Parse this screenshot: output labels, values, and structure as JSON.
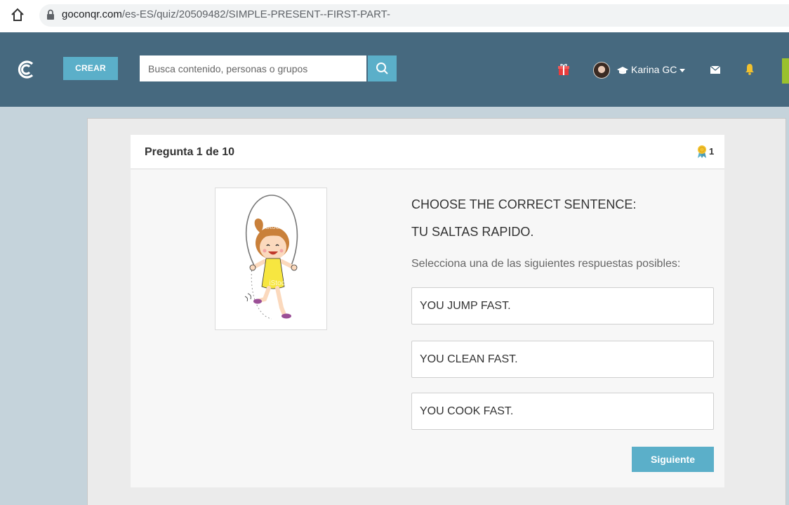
{
  "browser": {
    "url_domain": "goconqr.com",
    "url_path": "/es-ES/quiz/20509482/SIMPLE-PRESENT--FIRST-PART-"
  },
  "header": {
    "create_label": "CREAR",
    "search_placeholder": "Busca contenido, personas o grupos",
    "user_name": "Karina GC",
    "accent_color": "#5bafc9",
    "header_color": "#46697f"
  },
  "quiz": {
    "counter": "Pregunta 1 de 10",
    "points": "1",
    "question_line1": "CHOOSE THE CORRECT SENTENCE:",
    "question_line2": "TU SALTAS RAPIDO.",
    "instructions": "Selecciona una de las siguientes respuestas posibles:",
    "options": [
      "YOU JUMP FAST.",
      "YOU CLEAN FAST.",
      "YOU COOK FAST."
    ],
    "next_label": "Siguiente",
    "image_watermark": "iStock"
  }
}
